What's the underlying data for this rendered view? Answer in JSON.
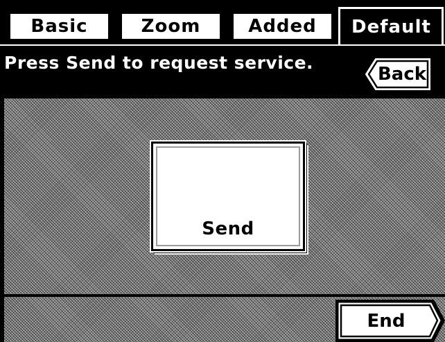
{
  "tabs": [
    {
      "label": "Basic",
      "active": false
    },
    {
      "label": "Zoom",
      "active": false
    },
    {
      "label": "Added",
      "active": false
    },
    {
      "label": "Default",
      "active": true
    }
  ],
  "message": {
    "text": "Press Send to request service."
  },
  "back_button": {
    "label": "Back",
    "icon": "left-arrow-tab"
  },
  "send_button": {
    "label": "Send"
  },
  "end_button": {
    "label": "End",
    "icon": "right-arrow-tab"
  },
  "colors": {
    "background": "#000000",
    "button_face": "#FFFFFF",
    "pattern": "#808080"
  }
}
